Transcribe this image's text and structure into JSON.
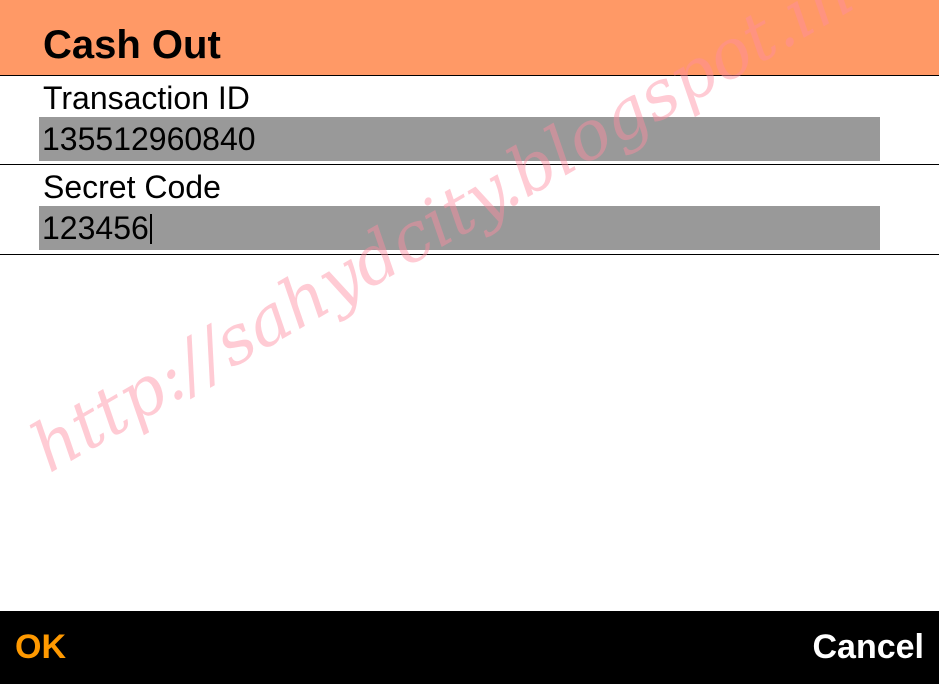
{
  "header": {
    "title": "Cash Out"
  },
  "fields": {
    "transaction_id": {
      "label": "Transaction ID",
      "value": "135512960840"
    },
    "secret_code": {
      "label": "Secret Code",
      "value": "123456"
    }
  },
  "watermark": {
    "text": "http://sahydcity.blogspot.in"
  },
  "softkeys": {
    "left_label": "OK",
    "right_label": "Cancel"
  },
  "colors": {
    "header_bg": "#ff9966",
    "input_bg": "#999999",
    "softkey_bar_bg": "#000000",
    "ok_color": "#ff9900",
    "cancel_color": "#ffffff"
  }
}
